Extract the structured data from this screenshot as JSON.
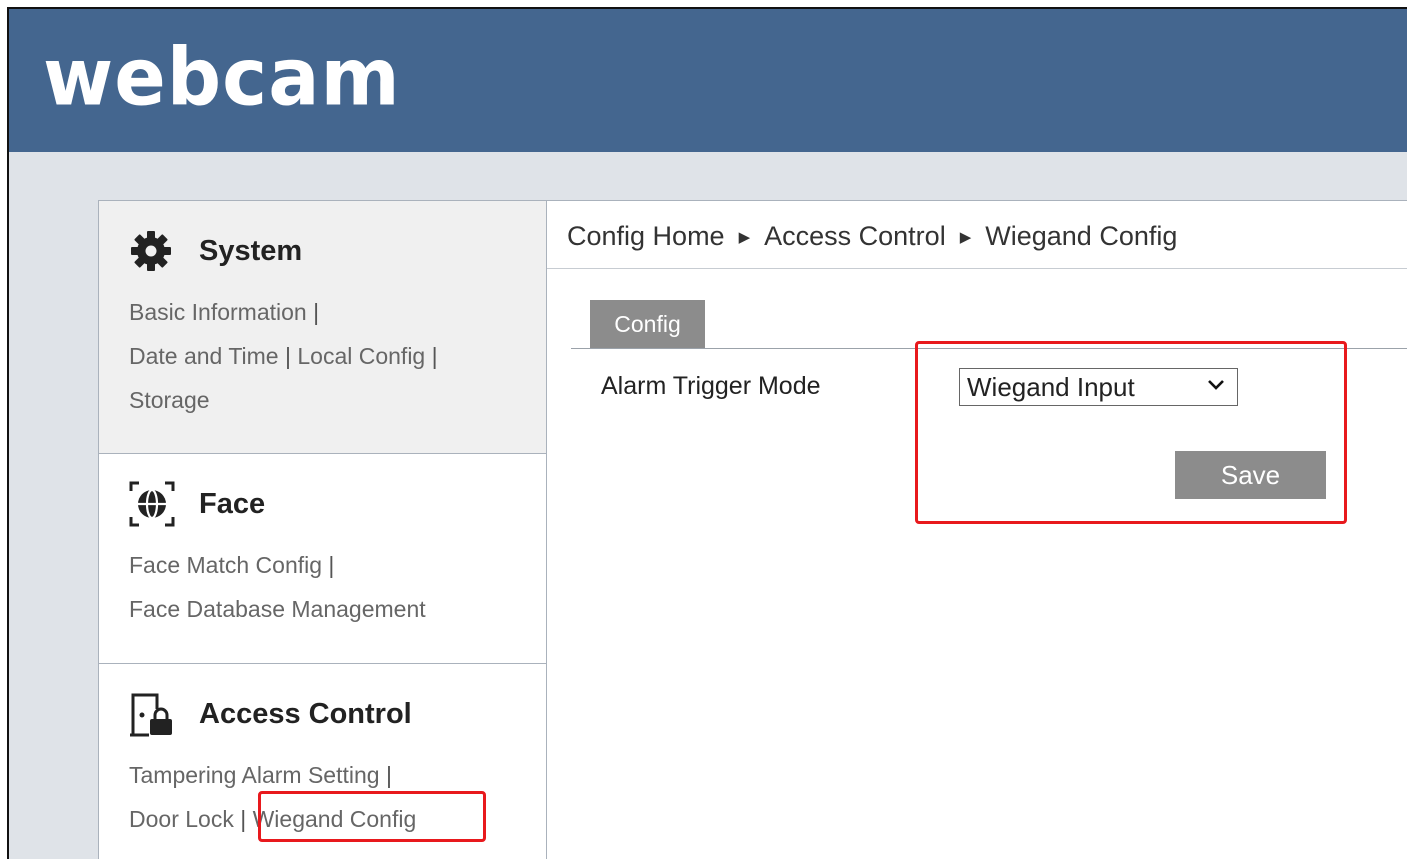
{
  "header": {
    "logo": "webcam"
  },
  "sidebar": {
    "system": {
      "title": "System",
      "links": [
        "Basic Information",
        "Date and Time",
        "Local Config",
        "Storage"
      ]
    },
    "face": {
      "title": "Face",
      "links": [
        "Face Match Config",
        "Face Database Management"
      ]
    },
    "access": {
      "title": "Access Control",
      "links": [
        "Tampering Alarm Setting",
        "Door Lock",
        "Wiegand Config"
      ]
    },
    "separator": "|"
  },
  "breadcrumb": [
    "Config Home",
    "Access Control",
    "Wiegand Config"
  ],
  "tab": "Config",
  "form": {
    "label": "Alarm Trigger Mode",
    "value": "Wiegand Input",
    "save": "Save"
  },
  "colors": {
    "header": "#44668f",
    "highlight": "#e8191d",
    "button": "#8c8c8c"
  }
}
